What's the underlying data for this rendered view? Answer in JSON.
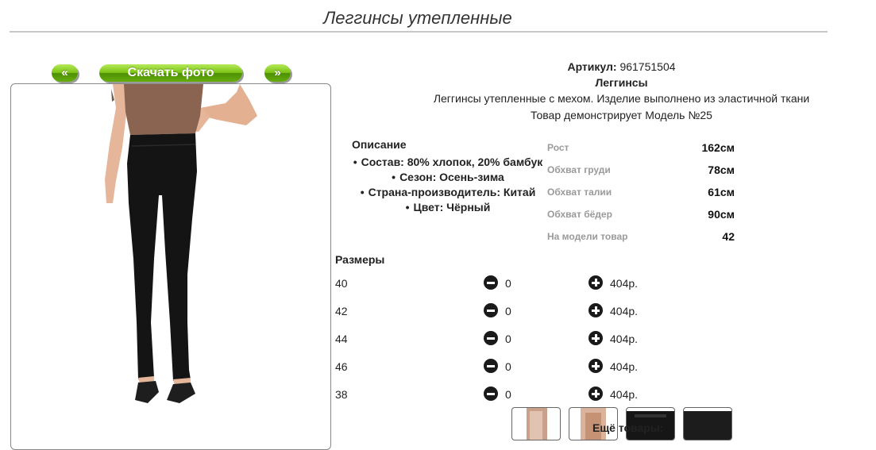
{
  "product": {
    "title": "Леггинсы утепленные",
    "article_label": "Артикул:",
    "article_value": "961751504",
    "category": "Леггинсы",
    "short_description": "Леггинсы утепленные с мехом. Изделие выполнено из эластичной ткани",
    "model_note": "Товар демонстрирует Модель №25"
  },
  "photo_nav": {
    "prev_label": "«",
    "download_label": "Скачать фото",
    "next_label": "»"
  },
  "description": {
    "title": "Описание",
    "items": [
      "Состав: 80% хлопок, 20% бамбук",
      "Сезон: Осень-зима",
      "Страна-производитель: Китай",
      "Цвет: Чёрный"
    ]
  },
  "model_params": [
    {
      "label": "Рост",
      "value": "162см"
    },
    {
      "label": "Обхват груди",
      "value": "78см"
    },
    {
      "label": "Обхват талии",
      "value": "61см"
    },
    {
      "label": "Обхват бёдер",
      "value": "90см"
    },
    {
      "label": "На модели товар",
      "value": "42"
    }
  ],
  "sizes": {
    "title": "Размеры",
    "rows": [
      {
        "size": "40",
        "qty": "0",
        "price": "404р."
      },
      {
        "size": "42",
        "qty": "0",
        "price": "404р."
      },
      {
        "size": "44",
        "qty": "0",
        "price": "404р."
      },
      {
        "size": "46",
        "qty": "0",
        "price": "404р."
      },
      {
        "size": "38",
        "qty": "0",
        "price": "404р."
      }
    ]
  },
  "more_products_label": "Ещё товары:",
  "colors": {
    "button_green": "#7cc314",
    "title_rule": "#c8c8c8",
    "param_label": "#9a9a9a",
    "leggings": "#141414",
    "skin": "#e6b69a",
    "bodysuit": "#8a6450"
  }
}
